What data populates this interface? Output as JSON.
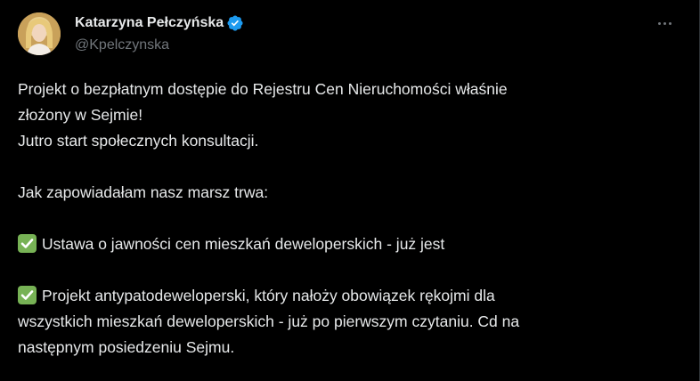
{
  "author": {
    "display_name": "Katarzyna Pełczyńska",
    "handle": "@Kpelczynska",
    "verified": true,
    "verified_color": "#1d9bf0"
  },
  "menu": {
    "more_icon": "more-horizontal-icon"
  },
  "tweet": {
    "line1": "Projekt o bezpłatnym dostępie do Rejestru Cen Nieruchomości właśnie",
    "line2": "złożony w Sejmie!",
    "line3": "Jutro start społecznych konsultacji.",
    "line4": "Jak zapowiadałam nasz marsz trwa:",
    "item1": "Ustawa o jawności cen mieszkań deweloperskich - już jest",
    "item2_line1": "Projekt antypatodeweloperski, który nałoży obowiązek rękojmi dla",
    "item2_line2": "wszystkich mieszkań deweloperskich - już po pierwszym czytaniu. Cd na",
    "item2_line3": "następnym posiedzeniu Sejmu.",
    "check_icon": "check-mark-button-emoji",
    "check_color": "#77b255"
  },
  "colors": {
    "background": "#000000",
    "text": "#e7e9ea",
    "muted": "#71767b"
  }
}
